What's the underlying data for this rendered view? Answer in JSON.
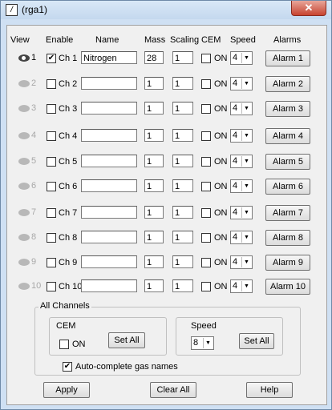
{
  "window": {
    "title": "(rga1)",
    "close_glyph": "✕"
  },
  "headers": {
    "view": "View",
    "enable": "Enable",
    "name": "Name",
    "mass": "Mass",
    "scaling": "Scaling",
    "cem": "CEM",
    "speed": "Speed",
    "alarms": "Alarms"
  },
  "channels": [
    {
      "view": "1",
      "ch": "Ch 1",
      "name": "Nitrogen",
      "mass": "28",
      "scaling": "1",
      "cem": "ON",
      "speed": "4",
      "alarm": "Alarm 1",
      "enabled": true
    },
    {
      "view": "2",
      "ch": "Ch 2",
      "name": "",
      "mass": "1",
      "scaling": "1",
      "cem": "ON",
      "speed": "4",
      "alarm": "Alarm 2",
      "enabled": false
    },
    {
      "view": "3",
      "ch": "Ch 3",
      "name": "",
      "mass": "1",
      "scaling": "1",
      "cem": "ON",
      "speed": "4",
      "alarm": "Alarm 3",
      "enabled": false
    },
    {
      "view": "4",
      "ch": "Ch 4",
      "name": "",
      "mass": "1",
      "scaling": "1",
      "cem": "ON",
      "speed": "4",
      "alarm": "Alarm 4",
      "enabled": false
    },
    {
      "view": "5",
      "ch": "Ch 5",
      "name": "",
      "mass": "1",
      "scaling": "1",
      "cem": "ON",
      "speed": "4",
      "alarm": "Alarm 5",
      "enabled": false
    },
    {
      "view": "6",
      "ch": "Ch 6",
      "name": "",
      "mass": "1",
      "scaling": "1",
      "cem": "ON",
      "speed": "4",
      "alarm": "Alarm 6",
      "enabled": false
    },
    {
      "view": "7",
      "ch": "Ch 7",
      "name": "",
      "mass": "1",
      "scaling": "1",
      "cem": "ON",
      "speed": "4",
      "alarm": "Alarm 7",
      "enabled": false
    },
    {
      "view": "8",
      "ch": "Ch 8",
      "name": "",
      "mass": "1",
      "scaling": "1",
      "cem": "ON",
      "speed": "4",
      "alarm": "Alarm 8",
      "enabled": false
    },
    {
      "view": "9",
      "ch": "Ch 9",
      "name": "",
      "mass": "1",
      "scaling": "1",
      "cem": "ON",
      "speed": "4",
      "alarm": "Alarm 9",
      "enabled": false
    },
    {
      "view": "10",
      "ch": "Ch 10",
      "name": "",
      "mass": "1",
      "scaling": "1",
      "cem": "ON",
      "speed": "4",
      "alarm": "Alarm 10",
      "enabled": false
    }
  ],
  "all_channels": {
    "title": "All Channels",
    "cem": {
      "title": "CEM",
      "checkbox_label": "ON",
      "button": "Set All"
    },
    "speed": {
      "title": "Speed",
      "value": "8",
      "button": "Set All"
    },
    "autocomplete": {
      "label": "Auto-complete gas names",
      "checked": true
    }
  },
  "footer": {
    "apply": "Apply",
    "clear_all": "Clear All",
    "help": "Help"
  },
  "icons": {
    "view": "eye-icon",
    "check": "✔",
    "dropdown": "▼"
  }
}
